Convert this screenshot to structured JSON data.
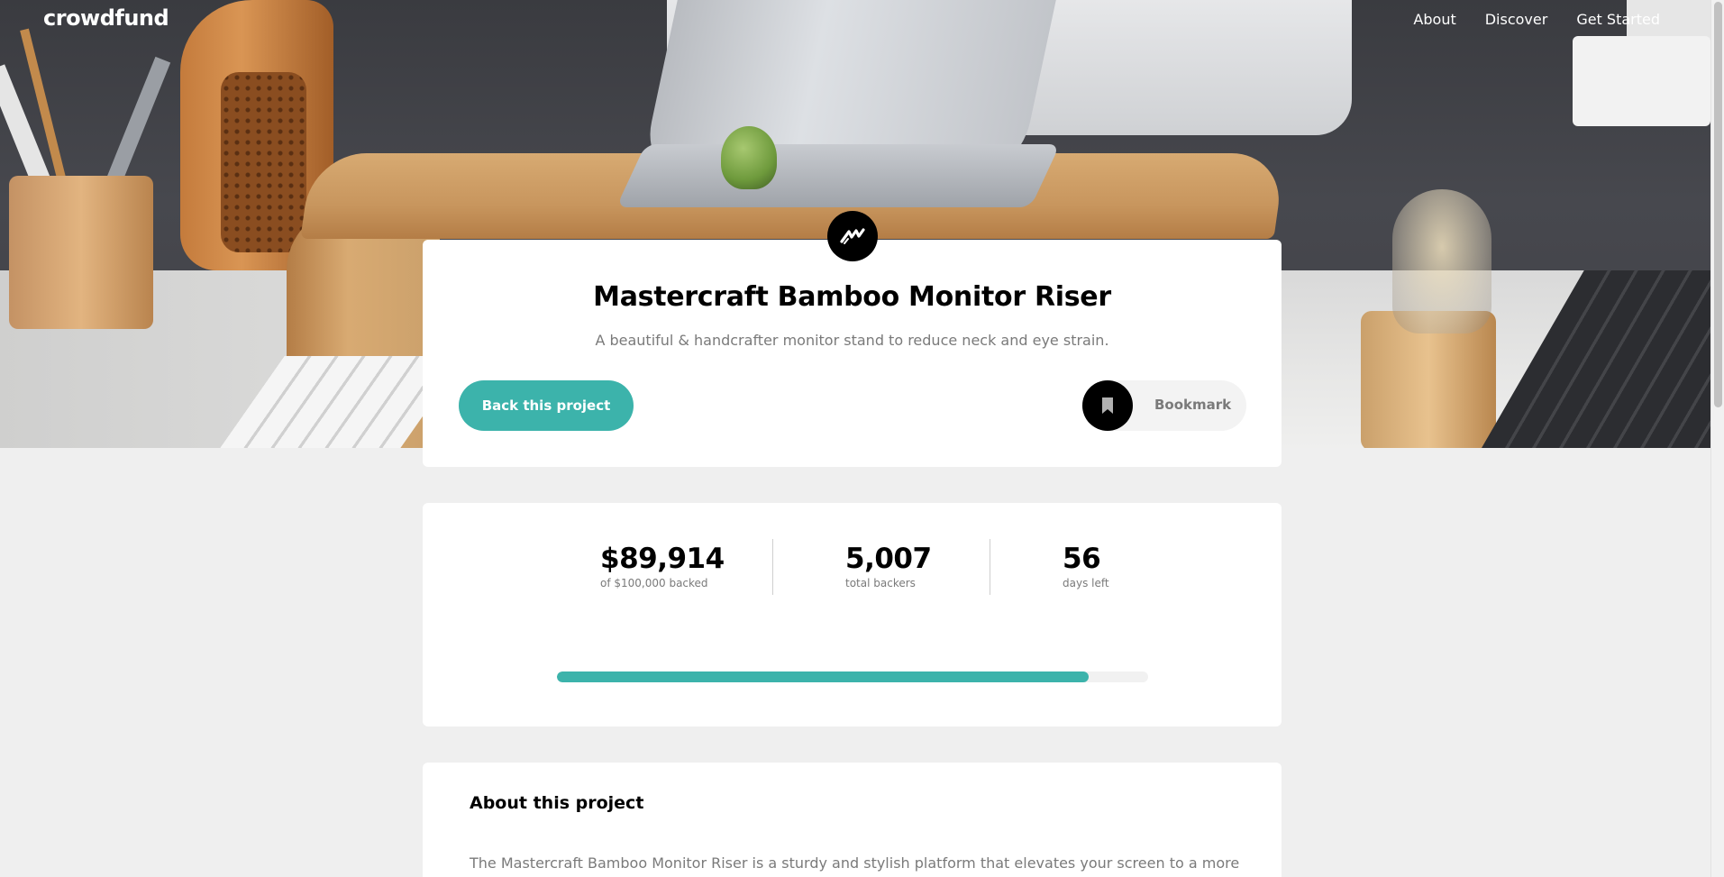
{
  "header": {
    "logo": "crowdfund",
    "nav": [
      "About",
      "Discover",
      "Get Started"
    ]
  },
  "project": {
    "title": "Mastercraft Bamboo Monitor Riser",
    "subtitle": "A beautiful & handcrafter monitor stand to reduce neck and eye strain.",
    "back_button_label": "Back this project",
    "bookmark_label": "Bookmark"
  },
  "stats": {
    "backed_amount": "$89,914",
    "backed_label": "of $100,000 backed",
    "total_backers": "5,007",
    "total_backers_label": "total backers",
    "days_left": "56",
    "days_left_label": "days left",
    "progress_fraction": 0.89914
  },
  "about": {
    "heading": "About this project",
    "text": "The Mastercraft Bamboo Monitor Riser is a sturdy and stylish platform that elevates your screen to a more"
  },
  "colors": {
    "accent": "#3cb3ab",
    "background": "#efefef",
    "card": "#ffffff",
    "muted_text": "#7a7a7a"
  },
  "icons": {
    "brand": "mastercraft-logo-icon",
    "bookmark": "bookmark-icon"
  }
}
